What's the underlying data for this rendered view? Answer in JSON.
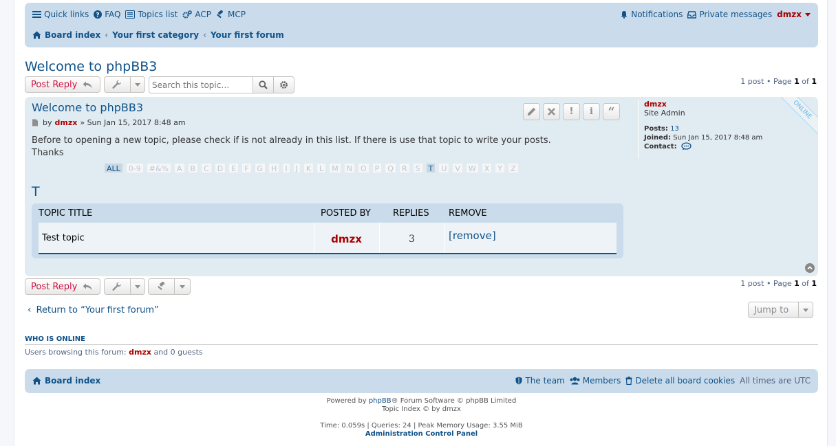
{
  "navbar": {
    "quick_links": "Quick links",
    "faq": "FAQ",
    "topics_list": "Topics list",
    "acp": "ACP",
    "mcp": "MCP",
    "notifications": "Notifications",
    "private_messages": "Private messages",
    "username": "dmzx",
    "breadcrumbs": [
      "Board index",
      "Your first category",
      "Your first forum"
    ]
  },
  "topic": {
    "title": "Welcome to phpBB3",
    "post_reply": "Post Reply",
    "search_placeholder": "Search this topic…",
    "pagination": {
      "prefix": "1 post • Page ",
      "page": "1",
      "of": " of ",
      "total": "1"
    }
  },
  "post": {
    "subject": "Welcome to phpBB3",
    "by": "by",
    "author": "dmzx",
    "date": "» Sun Jan 15, 2017 8:48 am",
    "body_line1": "Before to opening a new topic, please check if is not already in this list. If there is use that topic to write your posts.",
    "body_line2": "Thanks",
    "profile": {
      "username": "dmzx",
      "rank": "Site Admin",
      "posts_label": "Posts:",
      "posts_value": "13",
      "joined_label": "Joined:",
      "joined_value": "Sun Jan 15, 2017 8:48 am",
      "contact_label": "Contact:",
      "online": "ONLINE"
    },
    "alphabet": [
      "ALL",
      "0-9",
      "#&%",
      "A",
      "B",
      "C",
      "D",
      "E",
      "F",
      "G",
      "H",
      "I",
      "J",
      "K",
      "L",
      "M",
      "N",
      "O",
      "P",
      "Q",
      "R",
      "S",
      "T",
      "U",
      "V",
      "W",
      "X",
      "Y",
      "Z"
    ],
    "active_letter": "T",
    "letter_heading": "T",
    "table": {
      "headers": [
        "TOPIC TITLE",
        "POSTED BY",
        "REPLIES",
        "REMOVE"
      ],
      "rows": [
        {
          "title": "Test topic",
          "posted_by": "dmzx",
          "replies": "3",
          "remove": "[remove]"
        }
      ]
    }
  },
  "bottom": {
    "return_link": "Return to “Your first forum”",
    "jump_to": "Jump to"
  },
  "who_is_online": {
    "title": "WHO IS ONLINE",
    "text_prefix": "Users browsing this forum: ",
    "user": "dmzx",
    "text_suffix": " and 0 guests"
  },
  "footer": {
    "board_index": "Board index",
    "the_team": "The team",
    "members": "Members",
    "delete_cookies": "Delete all board cookies",
    "timezone": "All times are UTC"
  },
  "copyright": {
    "powered_prefix": "Powered by ",
    "phpbb": "phpBB",
    "powered_suffix": "® Forum Software © phpBB Limited",
    "topic_index": "Topic Index © by dmzx",
    "stats": "Time: 0.059s | Queries: 24 | Peak Memory Usage: 3.55 MiB",
    "acp_link": "Administration Control Panel"
  },
  "colors": {
    "accent": "#105289",
    "user_red": "#aa0000",
    "button_red": "#d31141",
    "navbar_bg": "#cadceb",
    "post_bg": "#e1ebf2"
  }
}
